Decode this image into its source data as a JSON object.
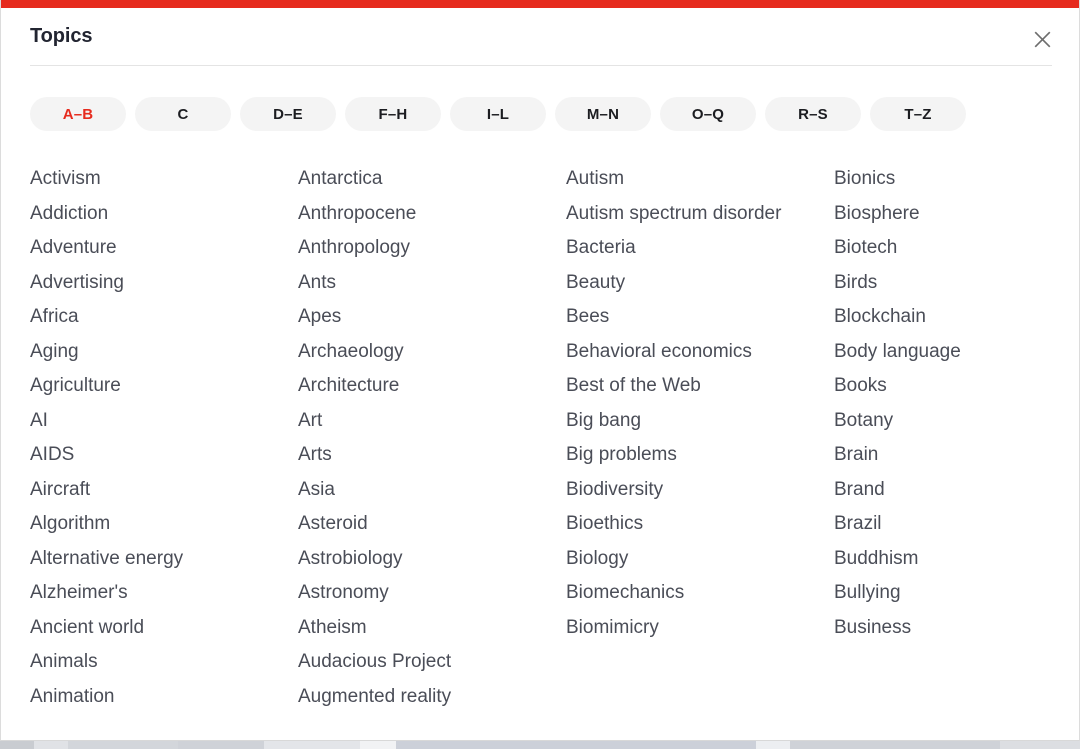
{
  "accent_color": "#e62b1e",
  "modal": {
    "title": "Topics",
    "close_icon": "close-icon",
    "close_label": "Close"
  },
  "tabs": [
    {
      "label": "A–B",
      "active": true
    },
    {
      "label": "C",
      "active": false
    },
    {
      "label": "D–E",
      "active": false
    },
    {
      "label": "F–H",
      "active": false
    },
    {
      "label": "I–L",
      "active": false
    },
    {
      "label": "M–N",
      "active": false
    },
    {
      "label": "O–Q",
      "active": false
    },
    {
      "label": "R–S",
      "active": false
    },
    {
      "label": "T–Z",
      "active": false
    }
  ],
  "columns": [
    {
      "items": [
        "Activism",
        "Addiction",
        "Adventure",
        "Advertising",
        "Africa",
        "Aging",
        "Agriculture",
        "AI",
        "AIDS",
        "Aircraft",
        "Algorithm",
        "Alternative energy",
        "Alzheimer's",
        "Ancient world",
        "Animals",
        "Animation"
      ]
    },
    {
      "items": [
        "Antarctica",
        "Anthropocene",
        "Anthropology",
        "Ants",
        "Apes",
        "Archaeology",
        "Architecture",
        "Art",
        "Arts",
        "Asia",
        "Asteroid",
        "Astrobiology",
        "Astronomy",
        "Atheism",
        "Audacious Project",
        "Augmented reality"
      ]
    },
    {
      "items": [
        "Autism",
        "Autism spectrum disorder",
        "Bacteria",
        "Beauty",
        "Bees",
        "Behavioral economics",
        "Best of the Web",
        "Big bang",
        "Big problems",
        "Biodiversity",
        "Bioethics",
        "Biology",
        "Biomechanics",
        "Biomimicry"
      ]
    },
    {
      "items": [
        "Bionics",
        "Biosphere",
        "Biotech",
        "Birds",
        "Blockchain",
        "Body language",
        "Books",
        "Botany",
        "Brain",
        "Brand",
        "Brazil",
        "Buddhism",
        "Bullying",
        "Business"
      ]
    }
  ]
}
